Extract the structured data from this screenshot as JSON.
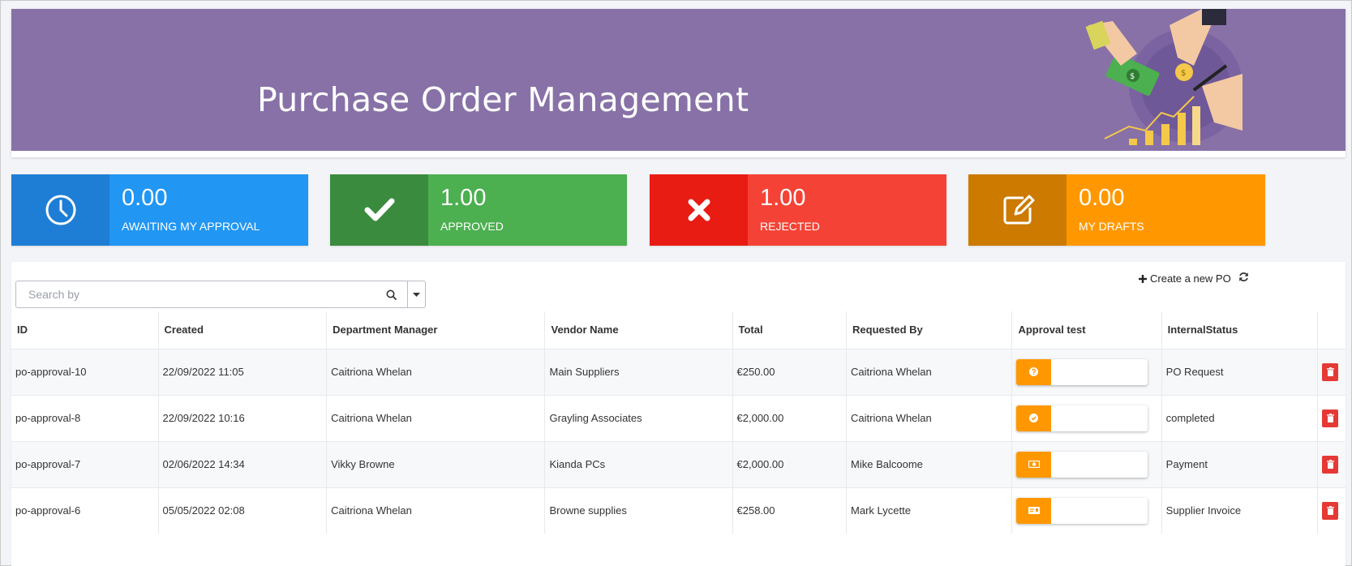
{
  "banner": {
    "title": "Purchase Order Management",
    "illustration": "finance-illustration"
  },
  "kpis": [
    {
      "value": "0.00",
      "label": "AWAITING MY APPROVAL",
      "icon": "clock-icon",
      "color": "#2196f3"
    },
    {
      "value": "1.00",
      "label": "APPROVED",
      "icon": "check-icon",
      "color": "#4caf50"
    },
    {
      "value": "1.00",
      "label": "REJECTED",
      "icon": "close-icon",
      "color": "#f44336"
    },
    {
      "value": "0.00",
      "label": "MY DRAFTS",
      "icon": "edit-icon",
      "color": "#ff9800"
    }
  ],
  "search": {
    "placeholder": "Search by"
  },
  "toolbar": {
    "create_label": "Create a new PO"
  },
  "table": {
    "columns": [
      "ID",
      "Created",
      "Department Manager",
      "Vendor Name",
      "Total",
      "Requested By",
      "Approval test",
      "InternalStatus"
    ],
    "rows": [
      {
        "id": "po-approval-10",
        "created": "22/09/2022 11:05",
        "manager": "Caitriona Whelan",
        "vendor": "Main Suppliers",
        "total": "€250.00",
        "requested_by": "Caitriona Whelan",
        "approval_icon": "question-icon",
        "status": "PO Request"
      },
      {
        "id": "po-approval-8",
        "created": "22/09/2022 10:16",
        "manager": "Caitriona Whelan",
        "vendor": "Grayling Associates",
        "total": "€2,000.00",
        "requested_by": "Caitriona Whelan",
        "approval_icon": "check-circle-icon",
        "status": "completed"
      },
      {
        "id": "po-approval-7",
        "created": "02/06/2022 14:34",
        "manager": "Vikky Browne",
        "vendor": "Kianda PCs",
        "total": "€2,000.00",
        "requested_by": "Mike Balcoome",
        "approval_icon": "money-icon",
        "status": "Payment"
      },
      {
        "id": "po-approval-6",
        "created": "05/05/2022 02:08",
        "manager": "Caitriona Whelan",
        "vendor": "Browne supplies",
        "total": "€258.00",
        "requested_by": "Mark Lycette",
        "approval_icon": "invoice-icon",
        "status": "Supplier Invoice"
      }
    ]
  }
}
